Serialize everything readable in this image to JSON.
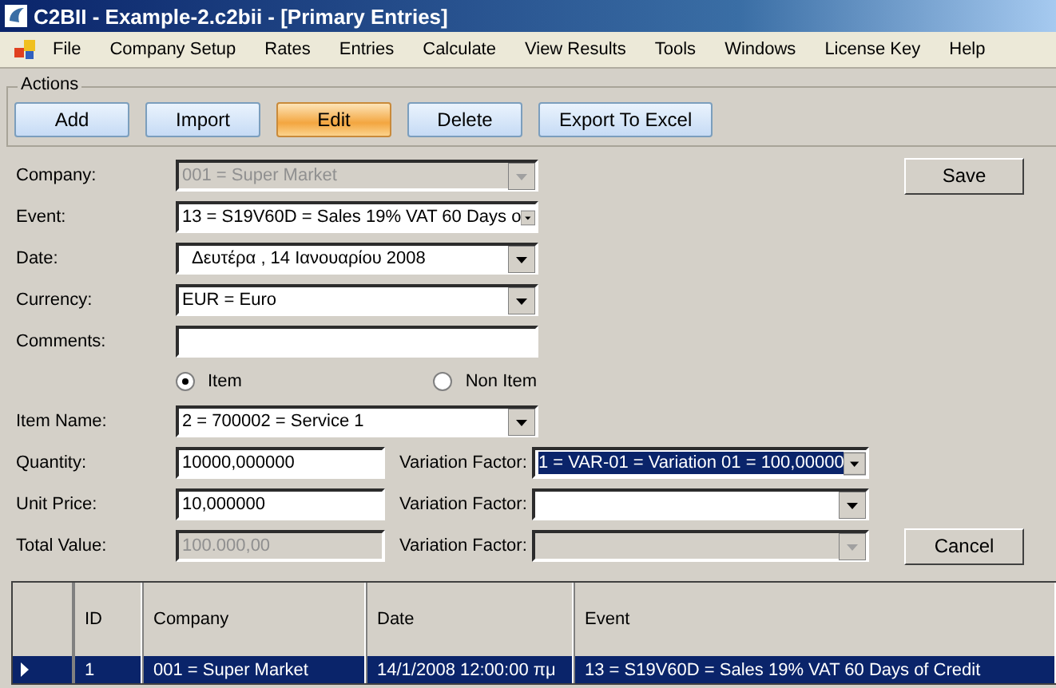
{
  "window": {
    "title": "C2BII - Example-2.c2bii - [Primary Entries]"
  },
  "menu": [
    "File",
    "Company Setup",
    "Rates",
    "Entries",
    "Calculate",
    "View Results",
    "Tools",
    "Windows",
    "License Key",
    "Help"
  ],
  "actions": {
    "title": "Actions",
    "buttons": [
      {
        "label": "Add",
        "selected": false
      },
      {
        "label": "Import",
        "selected": false
      },
      {
        "label": "Edit",
        "selected": true
      },
      {
        "label": "Delete",
        "selected": false
      },
      {
        "label": "Export To Excel",
        "selected": false
      }
    ]
  },
  "header_fields": [
    {
      "label": "Company:",
      "kind": "combo",
      "value": "001 = Super Market",
      "disabled": true
    },
    {
      "label": "Event:",
      "kind": "combo",
      "value": "13 = S19V60D = Sales 19% VAT 60 Days o",
      "disabled": false
    },
    {
      "label": "Date:",
      "kind": "date",
      "value": "Δευτέρα   , 14   Ιανουαρίου   2008",
      "disabled": false
    },
    {
      "label": "Currency:",
      "kind": "combo",
      "value": "EUR = Euro",
      "disabled": false
    },
    {
      "label": "Comments:",
      "kind": "text",
      "disabled": false
    }
  ],
  "item_type": [
    {
      "label": "Item",
      "selected": true
    },
    {
      "label": "Non Item",
      "selected": false
    }
  ],
  "item_name": {
    "label": "Item Name:",
    "value": "2 = 700002 = Service 1"
  },
  "amount_fields": [
    {
      "label": "Quantity:",
      "value": "10000,000000",
      "disabled": false,
      "variation": {
        "label": "Variation Factor:",
        "value": "1 = VAR-01 = Variation 01 = 100,00000",
        "disabled": false,
        "selected": true
      }
    },
    {
      "label": "Unit Price:",
      "value": "10,000000",
      "disabled": false,
      "variation": {
        "label": "Variation Factor:",
        "disabled": false,
        "selected": false
      }
    },
    {
      "label": "Total Value:",
      "value": "100.000,00",
      "disabled": true,
      "variation": {
        "label": "Variation Factor:",
        "disabled": true,
        "selected": false
      }
    }
  ],
  "save_button": "Save",
  "cancel_button": "Cancel",
  "table": {
    "columns": [
      "ID",
      "Company",
      "Date",
      "Event"
    ],
    "rows": [
      {
        "selected": true,
        "cells": [
          "1",
          "001 = Super Market",
          "14/1/2008 12:00:00 πμ",
          "13 = S19V60D = Sales 19% VAT 60 Days of Credit"
        ]
      }
    ]
  }
}
